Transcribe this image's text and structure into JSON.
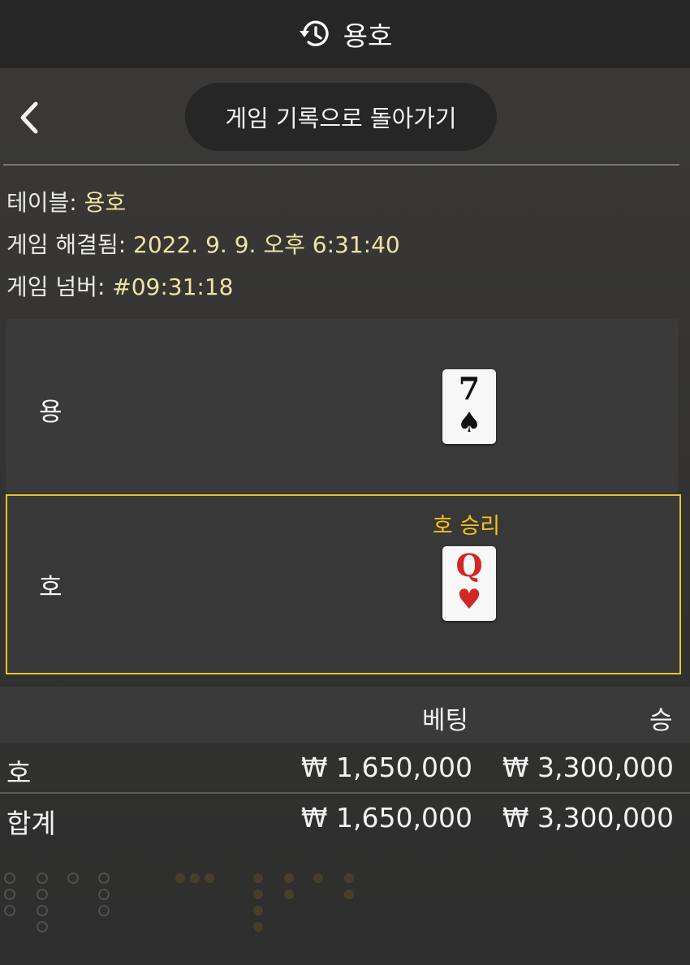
{
  "header": {
    "title": "용호",
    "icon": "history-icon"
  },
  "nav": {
    "back_icon": "chevron-left-icon",
    "return_label": "게임 기록으로 돌아가기"
  },
  "info": {
    "table_label": "테이블: ",
    "table_value": "용호",
    "resolved_label": "게임 해결됨: ",
    "resolved_value": "2022. 9. 9. 오후 6:31:40",
    "number_label": "게임 넘버: ",
    "number_value": "#09:31:18"
  },
  "rounds": {
    "dragon": {
      "label": "용",
      "card_rank": "7",
      "card_suit": "♠",
      "suit_name": "spade"
    },
    "tiger": {
      "label": "호",
      "card_rank": "Q",
      "card_suit": "♥",
      "suit_name": "heart",
      "result": "호 승리"
    }
  },
  "bets": {
    "headers": {
      "bet": "베팅",
      "win": "승"
    },
    "rows": [
      {
        "name": "호",
        "bet": "₩ 1,650,000",
        "win": "₩ 3,300,000"
      }
    ],
    "total": {
      "name": "합계",
      "bet": "₩ 1,650,000",
      "win": "₩ 3,300,000"
    }
  },
  "colors": {
    "accent": "#e6c431",
    "win_text": "#f1c21b",
    "value_text": "#efe3a3",
    "heart": "#d32727"
  }
}
